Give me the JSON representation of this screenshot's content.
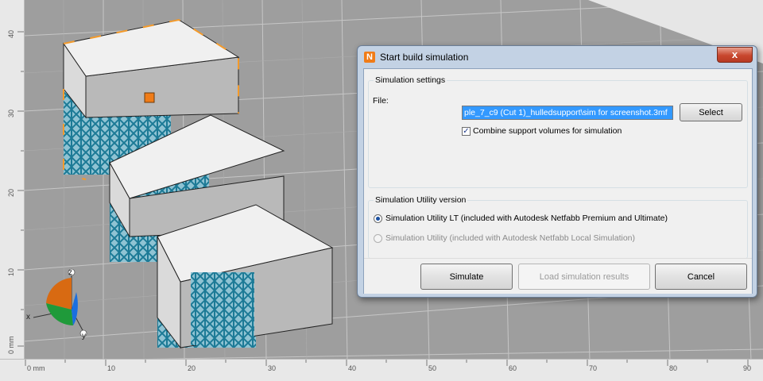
{
  "dialog": {
    "title": "Start build simulation",
    "app_icon_letter": "N",
    "close_symbol": "x",
    "settings": {
      "legend": "Simulation settings",
      "file_label": "File:",
      "file_value": "ple_7_c9 (Cut 1)_hulledsupport\\sim for screenshot.3mf",
      "select_label": "Select",
      "combine_checked": true,
      "combine_label": "Combine support volumes for simulation"
    },
    "version": {
      "legend": "Simulation Utility version",
      "option_lt": "Simulation Utility LT (included with Autodesk Netfabb Premium and Ultimate)",
      "option_lt_selected": true,
      "option_full": "Simulation Utility (included with Autodesk Netfabb Local Simulation)",
      "option_full_enabled": false
    },
    "buttons": {
      "simulate": "Simulate",
      "load": "Load simulation results",
      "cancel": "Cancel"
    }
  },
  "viewport": {
    "ruler_left": [
      "40",
      "30",
      "20",
      "10",
      "0 mm"
    ],
    "ruler_bottom": [
      "0 mm",
      "10",
      "20",
      "30",
      "40",
      "50",
      "60",
      "70",
      "80",
      "90"
    ],
    "axis_labels": {
      "x": "x",
      "y": "y",
      "z": "z"
    },
    "colors": {
      "plate": "#9e9e9e",
      "selection": "#f39a2b",
      "support": "#1c7a96",
      "part": "#ededed"
    }
  }
}
